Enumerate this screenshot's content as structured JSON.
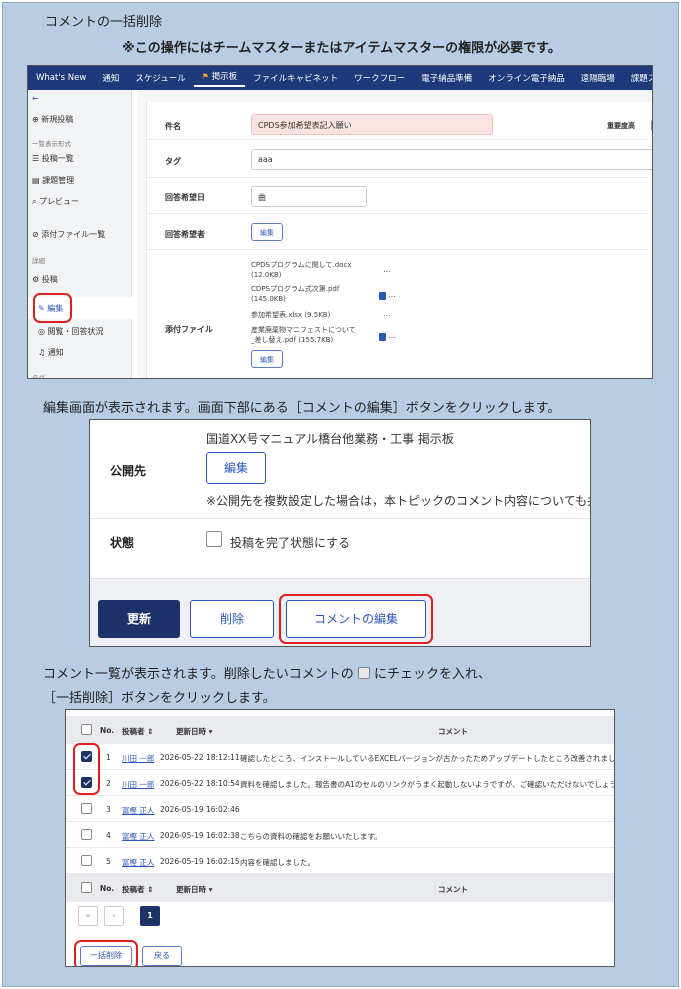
{
  "header": {
    "title": "コメントの一括削除",
    "warning": "※この操作にはチームマスターまたはアイテムマスターの権限が必要です。"
  },
  "shot1": {
    "nav": [
      "What's New",
      "通知",
      "スケジュール",
      "掲示板",
      "ファイルキャビネット",
      "ワークフロー",
      "電子納品準備",
      "オンライン電子納品",
      "遠隔臨場",
      "課題スレッド"
    ],
    "sidebar": {
      "back": "←",
      "new_post": "新規投稿",
      "section_list": "一覧表示形式",
      "post_list": "投稿一覧",
      "issue_mgmt": "課題管理",
      "preview": "プレビュー",
      "attach_list": "添付ファイル一覧",
      "section_detail": "詳細",
      "post": "投稿",
      "edit": "編集",
      "view_reply": "閲覧・回答状況",
      "notify": "通知",
      "section_tag": "タグ"
    },
    "form": {
      "subject_label": "件名",
      "subject_value": "CPDS参加希望表記入願い",
      "important_label": "重要度高",
      "tag_label": "タグ",
      "tag_value": "aaa",
      "due_label": "回答希望日",
      "due_value": "曲",
      "respondent_label": "回答希望者",
      "edit_btn": "編集",
      "attach_label": "添付ファイル",
      "files": [
        {
          "name": "CPDSプログラムに関して.docx",
          "size": "(12.0KB)"
        },
        {
          "name": "CDPSプログラム式次第.pdf",
          "size": "(145.0KB)"
        },
        {
          "name": "参加希望表.xlsx (9.5KB)",
          "size": ""
        },
        {
          "name": "産業廃棄物マニフェストについて",
          "size": "_差し替え.pdf (155.7KB)"
        }
      ],
      "more": "…",
      "attach_edit_btn": "編集"
    }
  },
  "caption1": "編集画面が表示されます。画面下部にある［コメントの編集］ボタンをクリックします。",
  "shot2": {
    "board_name": "国道XX号マニュアル橋台他業務・工事 掲示板",
    "publish_label": "公開先",
    "edit_btn": "編集",
    "note": "※公開先を複数設定した場合は，本トピックのコメント内容についても共",
    "status_label": "状態",
    "complete_label": "投稿を完了状態にする",
    "update_btn": "更新",
    "delete_btn": "削除",
    "comment_edit_btn": "コメントの編集"
  },
  "caption2a": "コメント一覧が表示されます。削除したいコメントの",
  "caption2b": "にチェックを入れ、",
  "caption3": "［一括削除］ボタンをクリックします。",
  "shot3": {
    "headers": {
      "no": "No.",
      "poster": "投稿者 ⇕",
      "date": "更新日時 ▾",
      "comment": "コメント"
    },
    "rows": [
      {
        "no": "1",
        "poster": "川田 一郎",
        "date": "2026-05-22 18:12:11",
        "comment": "確認したところ、インストールしているEXCELバージョンが古かったためアップデートしたところ改善されました。ま",
        "checked": true
      },
      {
        "no": "2",
        "poster": "川田 一郎",
        "date": "2026-05-22 18:10:54",
        "comment": "資料を確認しました。報告書のA1のセルのリンクがうまく起動しないようですが、ご確認いただけないでしょうか。",
        "checked": true
      },
      {
        "no": "3",
        "poster": "富樫 正人",
        "date": "2026-05-19 16:02:46",
        "comment": "",
        "checked": false
      },
      {
        "no": "4",
        "poster": "富樫 正人",
        "date": "2026-05-19 16:02:38",
        "comment": "こちらの資料の確認をお願いいたします。",
        "checked": false
      },
      {
        "no": "5",
        "poster": "富樫 正人",
        "date": "2026-05-19 16:02:15",
        "comment": "内容を確認しました。",
        "checked": false
      }
    ],
    "pager": {
      "first": "«",
      "prev": "‹",
      "current": "1"
    },
    "bulk_delete_btn": "一括削除",
    "back_btn": "戻る"
  }
}
